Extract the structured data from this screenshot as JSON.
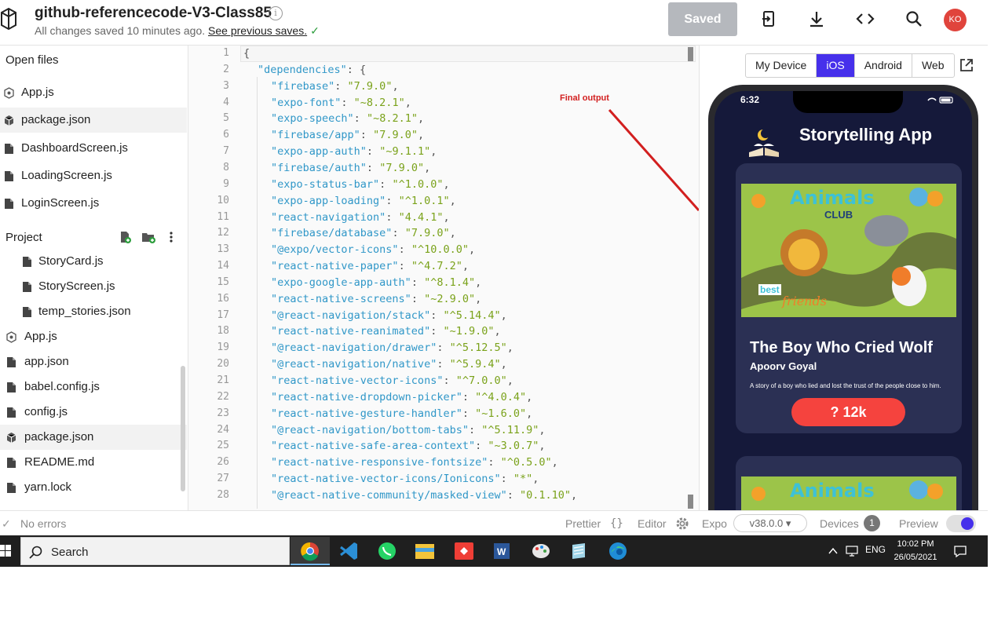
{
  "header": {
    "project_title": "github-referencecode-V3-Class85",
    "save_status": "All changes saved 10 minutes ago.",
    "previous_saves_link": "See previous saves.",
    "saved_button": "Saved",
    "avatar_initials": "KO",
    "icons": [
      "logo-icon",
      "info-icon",
      "export-icon",
      "download-icon",
      "embed-icon",
      "search-icon"
    ]
  },
  "sidebar": {
    "open_files_label": "Open files",
    "open_files": [
      {
        "name": "App.js",
        "icon": "react-icon",
        "active": false
      },
      {
        "name": "package.json",
        "icon": "package-icon",
        "active": true
      },
      {
        "name": "DashboardScreen.js",
        "icon": "file-icon",
        "active": false
      },
      {
        "name": "LoadingScreen.js",
        "icon": "file-icon",
        "active": false
      },
      {
        "name": "LoginScreen.js",
        "icon": "file-icon",
        "active": false
      }
    ],
    "project_label": "Project",
    "project_files": [
      {
        "name": "StoryCard.js",
        "icon": "file-icon",
        "nested": true,
        "active": false
      },
      {
        "name": "StoryScreen.js",
        "icon": "file-icon",
        "nested": true,
        "active": false
      },
      {
        "name": "temp_stories.json",
        "icon": "file-icon",
        "nested": true,
        "active": false
      },
      {
        "name": "App.js",
        "icon": "react-icon",
        "nested": false,
        "active": false
      },
      {
        "name": "app.json",
        "icon": "file-icon",
        "nested": false,
        "active": false
      },
      {
        "name": "babel.config.js",
        "icon": "file-icon",
        "nested": false,
        "active": false
      },
      {
        "name": "config.js",
        "icon": "file-icon",
        "nested": false,
        "active": false
      },
      {
        "name": "package.json",
        "icon": "package-icon",
        "nested": false,
        "active": true
      },
      {
        "name": "README.md",
        "icon": "file-icon",
        "nested": false,
        "active": false
      },
      {
        "name": "yarn.lock",
        "icon": "file-icon",
        "nested": false,
        "active": false
      }
    ]
  },
  "editor": {
    "lines": [
      {
        "n": "1",
        "key": "",
        "val": "",
        "raw": "{"
      },
      {
        "n": "2",
        "key": "\"dependencies\"",
        "val": "",
        "raw": ": {"
      },
      {
        "n": "3",
        "key": "\"firebase\"",
        "val": "\"7.9.0\""
      },
      {
        "n": "4",
        "key": "\"expo-font\"",
        "val": "\"~8.2.1\""
      },
      {
        "n": "5",
        "key": "\"expo-speech\"",
        "val": "\"~8.2.1\""
      },
      {
        "n": "6",
        "key": "\"firebase/app\"",
        "val": "\"7.9.0\""
      },
      {
        "n": "7",
        "key": "\"expo-app-auth\"",
        "val": "\"~9.1.1\""
      },
      {
        "n": "8",
        "key": "\"firebase/auth\"",
        "val": "\"7.9.0\""
      },
      {
        "n": "9",
        "key": "\"expo-status-bar\"",
        "val": "\"^1.0.0\""
      },
      {
        "n": "10",
        "key": "\"expo-app-loading\"",
        "val": "\"^1.0.1\""
      },
      {
        "n": "11",
        "key": "\"react-navigation\"",
        "val": "\"4.4.1\""
      },
      {
        "n": "12",
        "key": "\"firebase/database\"",
        "val": "\"7.9.0\""
      },
      {
        "n": "13",
        "key": "\"@expo/vector-icons\"",
        "val": "\"^10.0.0\""
      },
      {
        "n": "14",
        "key": "\"react-native-paper\"",
        "val": "\"^4.7.2\""
      },
      {
        "n": "15",
        "key": "\"expo-google-app-auth\"",
        "val": "\"^8.1.4\""
      },
      {
        "n": "16",
        "key": "\"react-native-screens\"",
        "val": "\"~2.9.0\""
      },
      {
        "n": "17",
        "key": "\"@react-navigation/stack\"",
        "val": "\"^5.14.4\""
      },
      {
        "n": "18",
        "key": "\"react-native-reanimated\"",
        "val": "\"~1.9.0\""
      },
      {
        "n": "19",
        "key": "\"@react-navigation/drawer\"",
        "val": "\"^5.12.5\""
      },
      {
        "n": "20",
        "key": "\"@react-navigation/native\"",
        "val": "\"^5.9.4\""
      },
      {
        "n": "21",
        "key": "\"react-native-vector-icons\"",
        "val": "\"^7.0.0\""
      },
      {
        "n": "22",
        "key": "\"react-native-dropdown-picker\"",
        "val": "\"^4.0.4\""
      },
      {
        "n": "23",
        "key": "\"react-native-gesture-handler\"",
        "val": "\"~1.6.0\""
      },
      {
        "n": "24",
        "key": "\"@react-navigation/bottom-tabs\"",
        "val": "\"^5.11.9\""
      },
      {
        "n": "25",
        "key": "\"react-native-safe-area-context\"",
        "val": "\"~3.0.7\""
      },
      {
        "n": "26",
        "key": "\"react-native-responsive-fontsize\"",
        "val": "\"^0.5.0\""
      },
      {
        "n": "27",
        "key": "\"react-native-vector-icons/Ionicons\"",
        "val": "\"*\""
      },
      {
        "n": "28",
        "key": "\"@react-native-community/masked-view\"",
        "val": "\"0.1.10\""
      }
    ],
    "annotation": "Final output",
    "annotation_color": "#d21f1f",
    "key_color": "#3097c8",
    "value_color": "#7aa21a"
  },
  "preview": {
    "device_tabs": [
      {
        "label": "My Device",
        "active": false
      },
      {
        "label": "iOS",
        "active": true
      },
      {
        "label": "Android",
        "active": false
      },
      {
        "label": "Web",
        "active": false
      }
    ],
    "phone": {
      "time": "6:32",
      "app_title": "Storytelling App",
      "story": {
        "title": "The Boy Who Cried Wolf",
        "author": "Apoorv Goyal",
        "description": "A story of a boy who lied and lost the trust of the people close to him.",
        "likes": "? 12k"
      },
      "image_texts": {
        "animals": "Animals",
        "club": "CLUB",
        "best": "best",
        "friends": "friends"
      }
    }
  },
  "statusbar": {
    "errors": "No errors",
    "prettier": "Prettier",
    "editor": "Editor",
    "expo": "Expo",
    "expo_version": "v38.0.0 ▾",
    "devices": "Devices",
    "devices_count": "1",
    "preview": "Preview"
  },
  "taskbar": {
    "search_label": "Search",
    "apps": [
      "chrome-icon",
      "vscode-icon",
      "whatsapp-icon",
      "file-explorer-icon",
      "anydesk-icon",
      "word-icon",
      "paint-icon",
      "notepad-icon",
      "edge-icon"
    ],
    "lang": "ENG",
    "time": "10:02 PM",
    "date": "26/05/2021"
  }
}
